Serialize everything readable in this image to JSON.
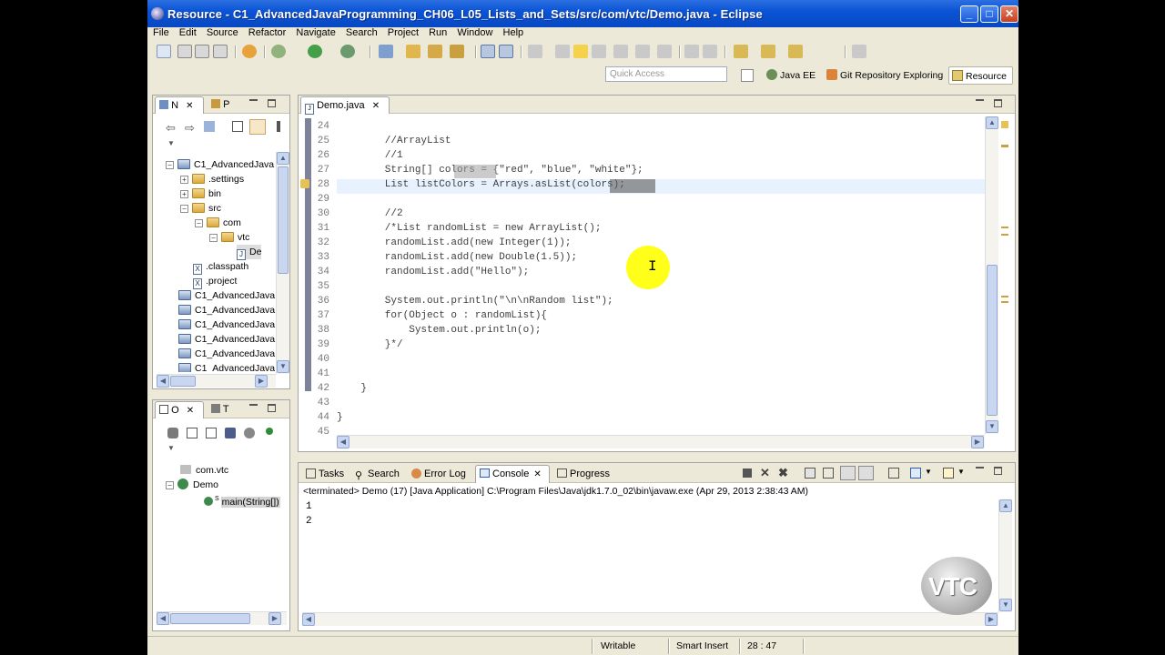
{
  "window": {
    "title": "Resource - C1_AdvancedJavaProgramming_CH06_L05_Lists_and_Sets/src/com/vtc/Demo.java - Eclipse"
  },
  "menu": [
    "File",
    "Edit",
    "Source",
    "Refactor",
    "Navigate",
    "Search",
    "Project",
    "Run",
    "Window",
    "Help"
  ],
  "quick_access": {
    "placeholder": "Quick Access"
  },
  "perspectives": [
    "Java EE",
    "Git Repository Exploring",
    "Resource"
  ],
  "navigator": {
    "tabs": [
      "N",
      "P"
    ],
    "tree": [
      {
        "label": "C1_AdvancedJava",
        "type": "project",
        "toggle": "−"
      },
      {
        "label": ".settings",
        "type": "folder",
        "toggle": "+"
      },
      {
        "label": "bin",
        "type": "folder",
        "toggle": "+"
      },
      {
        "label": "src",
        "type": "folder",
        "toggle": "−"
      },
      {
        "label": "com",
        "type": "folder",
        "toggle": "−"
      },
      {
        "label": "vtc",
        "type": "folder",
        "toggle": "−"
      },
      {
        "label": "De",
        "type": "file"
      },
      {
        "label": ".classpath",
        "type": "file"
      },
      {
        "label": ".project",
        "type": "file"
      },
      {
        "label": "C1_AdvancedJava",
        "type": "project"
      },
      {
        "label": "C1_AdvancedJava",
        "type": "project"
      },
      {
        "label": "C1_AdvancedJava",
        "type": "project"
      },
      {
        "label": "C1_AdvancedJava",
        "type": "project"
      },
      {
        "label": "C1_AdvancedJava",
        "type": "project"
      },
      {
        "label": "C1_AdvancedJava",
        "type": "project"
      }
    ]
  },
  "outline": {
    "tabs": [
      "O",
      "T"
    ],
    "items": [
      "com.vtc",
      "Demo",
      "main(String[])"
    ],
    "superscript": "S"
  },
  "editor": {
    "tab": "Demo.java",
    "lines": [
      {
        "n": "24",
        "text": ""
      },
      {
        "n": "25",
        "text": "        //ArrayList"
      },
      {
        "n": "26",
        "text": "        //1"
      },
      {
        "n": "27",
        "text": "        String[] colors = {\"red\", \"blue\", \"white\"};"
      },
      {
        "n": "28",
        "text": "        List listColors = Arrays.asList(colors);"
      },
      {
        "n": "29",
        "text": ""
      },
      {
        "n": "30",
        "text": "        //2"
      },
      {
        "n": "31",
        "text": "        /*List randomList = new ArrayList();"
      },
      {
        "n": "32",
        "text": "        randomList.add(new Integer(1));"
      },
      {
        "n": "33",
        "text": "        randomList.add(new Double(1.5));"
      },
      {
        "n": "34",
        "text": "        randomList.add(\"Hello\");"
      },
      {
        "n": "35",
        "text": ""
      },
      {
        "n": "36",
        "text": "        System.out.println(\"\\n\\nRandom list\");"
      },
      {
        "n": "37",
        "text": "        for(Object o : randomList){"
      },
      {
        "n": "38",
        "text": "            System.out.println(o);"
      },
      {
        "n": "39",
        "text": "        }*/"
      },
      {
        "n": "40",
        "text": ""
      },
      {
        "n": "41",
        "text": ""
      },
      {
        "n": "42",
        "text": "    }"
      },
      {
        "n": "43",
        "text": ""
      },
      {
        "n": "44",
        "text": "}"
      },
      {
        "n": "45",
        "text": ""
      }
    ]
  },
  "console": {
    "tabs": [
      "Tasks",
      "Search",
      "Error Log",
      "Console",
      "Progress"
    ],
    "header": "<terminated> Demo (17) [Java Application] C:\\Program Files\\Java\\jdk1.7.0_02\\bin\\javaw.exe (Apr 29, 2013 2:38:43 AM)",
    "output": [
      "1",
      "2"
    ]
  },
  "status": {
    "mode": "Writable",
    "insert": "Smart Insert",
    "position": "28 : 47"
  },
  "watermark": "VTC"
}
